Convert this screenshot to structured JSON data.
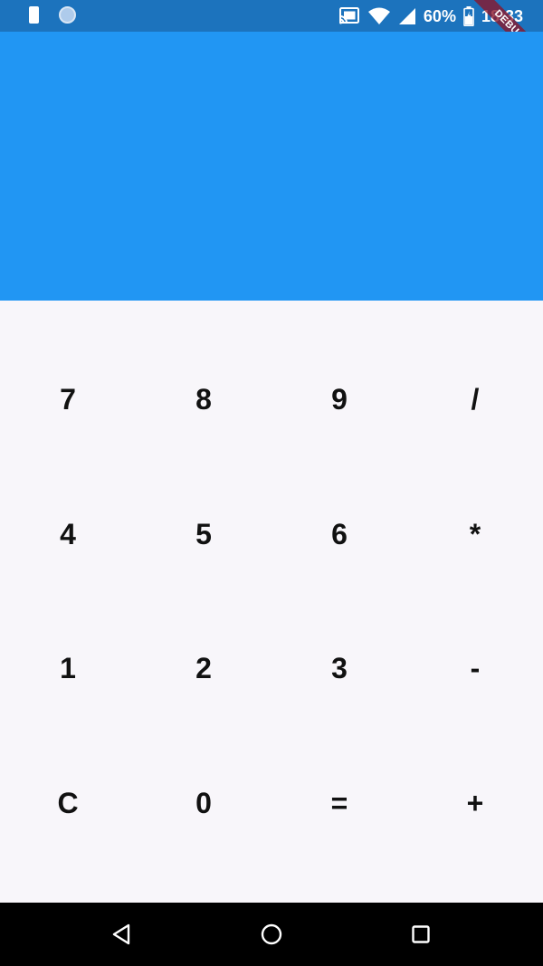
{
  "status_bar": {
    "battery_percent": "60%",
    "time": "18:33",
    "icons": [
      "sim-card-icon",
      "circle-notification-icon",
      "cast-icon",
      "wifi-icon",
      "cell-signal-icon",
      "battery-charging-icon"
    ]
  },
  "debug_banner": "DEBUG",
  "display": {
    "color": "#2196f3"
  },
  "keypad": {
    "rows": [
      [
        "7",
        "8",
        "9",
        "/"
      ],
      [
        "4",
        "5",
        "6",
        "*"
      ],
      [
        "1",
        "2",
        "3",
        "-"
      ],
      [
        "C",
        "0",
        "=",
        "+"
      ]
    ]
  },
  "nav_bar": {
    "buttons": [
      "back-icon",
      "home-icon",
      "recents-icon"
    ]
  },
  "colors": {
    "status_bar": "#1c73bd",
    "display": "#2196f3",
    "keypad_background": "#f8f6fa",
    "key_text": "#111111",
    "nav_bar": "#000000",
    "debug_ribbon": "#8c1428"
  }
}
